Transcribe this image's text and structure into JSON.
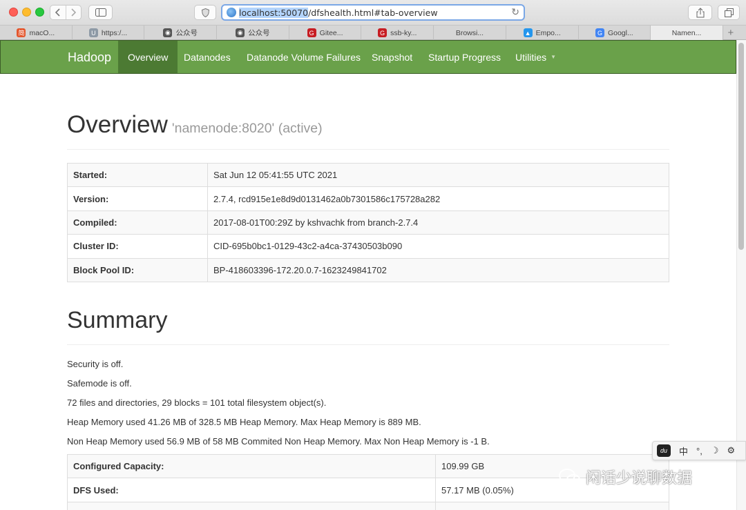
{
  "browser": {
    "url_host": "localhost:50070",
    "url_path": "/dfshealth.html#tab-overview",
    "tabs": [
      {
        "label": "macO...",
        "icon": "jianshu-icon",
        "color": "#e4572e",
        "glyph": "简"
      },
      {
        "label": "https:/...",
        "icon": "u-icon",
        "color": "#8e9aa6",
        "glyph": "U"
      },
      {
        "label": "公众号",
        "icon": "wechat-icon",
        "color": "#555555",
        "glyph": "◉"
      },
      {
        "label": "公众号",
        "icon": "wechat-icon",
        "color": "#555555",
        "glyph": "◉"
      },
      {
        "label": "Gitee...",
        "icon": "gitee-icon",
        "color": "#c71d23",
        "glyph": "G"
      },
      {
        "label": "ssb-ky...",
        "icon": "gitee-icon",
        "color": "#c71d23",
        "glyph": "G"
      },
      {
        "label": "Browsi...",
        "icon": "",
        "color": "",
        "glyph": ""
      },
      {
        "label": "Empo...",
        "icon": "docker-icon",
        "color": "#2496ed",
        "glyph": "▲"
      },
      {
        "label": "Googl...",
        "icon": "google-translate-icon",
        "color": "#4285f4",
        "glyph": "G"
      },
      {
        "label": "Namen...",
        "icon": "",
        "color": "",
        "glyph": ""
      }
    ]
  },
  "navbar": {
    "brand": "Hadoop",
    "items": [
      "Overview",
      "Datanodes",
      "Datanode Volume Failures",
      "Snapshot",
      "Startup Progress",
      "Utilities"
    ],
    "active": "Overview"
  },
  "overview": {
    "title": "Overview",
    "subtitle": "'namenode:8020' (active)",
    "rows": [
      {
        "key": "Started:",
        "value": "Sat Jun 12 05:41:55 UTC 2021"
      },
      {
        "key": "Version:",
        "value": "2.7.4, rcd915e1e8d9d0131462a0b7301586c175728a282"
      },
      {
        "key": "Compiled:",
        "value": "2017-08-01T00:29Z by kshvachk from branch-2.7.4"
      },
      {
        "key": "Cluster ID:",
        "value": "CID-695b0bc1-0129-43c2-a4ca-37430503b090"
      },
      {
        "key": "Block Pool ID:",
        "value": "BP-418603396-172.20.0.7-1623249841702"
      }
    ]
  },
  "summary": {
    "title": "Summary",
    "lines": [
      "Security is off.",
      "Safemode is off.",
      "72 files and directories, 29 blocks = 101 total filesystem object(s).",
      "Heap Memory used 41.26 MB of 328.5 MB Heap Memory. Max Heap Memory is 889 MB.",
      "Non Heap Memory used 56.9 MB of 58 MB Commited Non Heap Memory. Max Non Heap Memory is -1 B."
    ],
    "rows": [
      {
        "key": "Configured Capacity:",
        "value": "109.99 GB"
      },
      {
        "key": "DFS Used:",
        "value": "57.17 MB (0.05%)"
      },
      {
        "key": "",
        "value": ""
      }
    ]
  },
  "ime": {
    "badge": "du",
    "lang": "中",
    "punct": "°,",
    "moon": "☽",
    "gear": "⚙"
  },
  "watermark": {
    "text": "闲话少说聊数据"
  },
  "colors": {
    "navbar": "#6aa14a",
    "navbar_active": "#4c7a33"
  }
}
